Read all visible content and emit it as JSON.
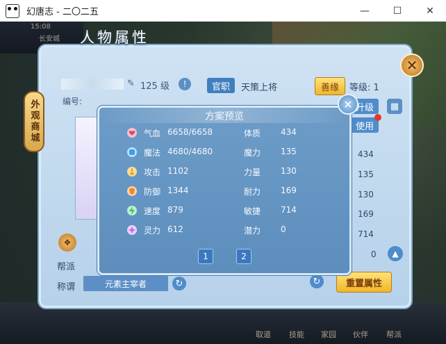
{
  "window": {
    "title": "幻唐志 - 二〇二五",
    "minimize_icon": "minimize-icon",
    "maximize_icon": "maximize-icon",
    "close_icon": "close-icon"
  },
  "hud": {
    "time": "15:08",
    "location": "长安城",
    "bottom_nav": [
      "取道",
      "技能",
      "家园",
      "伙伴",
      "帮派"
    ]
  },
  "panel": {
    "title": "人物属性",
    "side_tab": "外观商城",
    "level": "125 级",
    "role_badge": "官职",
    "role_value": "天策上将",
    "good_button": "善缘",
    "grade": "等级: 1",
    "id_label": "编号:",
    "upgrade_button": "升级",
    "use_button": "使用",
    "right_values": [
      "434",
      "135",
      "130",
      "169",
      "714",
      "0"
    ],
    "faction_label": "帮派",
    "title_label": "称谓",
    "title_value": "元素主宰者",
    "reset_button": "重置属性"
  },
  "preview": {
    "title": "方案预览",
    "stats": [
      {
        "icon": "heart-icon",
        "color": "#e0446a",
        "name": "气血",
        "value": "6658/6658",
        "name2": "体质",
        "value2": "434"
      },
      {
        "icon": "mana-icon",
        "color": "#3aa0ee",
        "name": "魔法",
        "value": "4680/4680",
        "name2": "魔力",
        "value2": "135"
      },
      {
        "icon": "attack-icon",
        "color": "#f0a01e",
        "name": "攻击",
        "value": "1102",
        "name2": "力量",
        "value2": "130"
      },
      {
        "icon": "defense-icon",
        "color": "#f08a2a",
        "name": "防御",
        "value": "1344",
        "name2": "耐力",
        "value2": "169"
      },
      {
        "icon": "speed-icon",
        "color": "#34c06a",
        "name": "速度",
        "value": "879",
        "name2": "敏捷",
        "value2": "714"
      },
      {
        "icon": "spirit-icon",
        "color": "#c06ae8",
        "name": "灵力",
        "value": "612",
        "name2": "潜力",
        "value2": "0"
      }
    ],
    "pages": [
      "1",
      "2"
    ]
  }
}
